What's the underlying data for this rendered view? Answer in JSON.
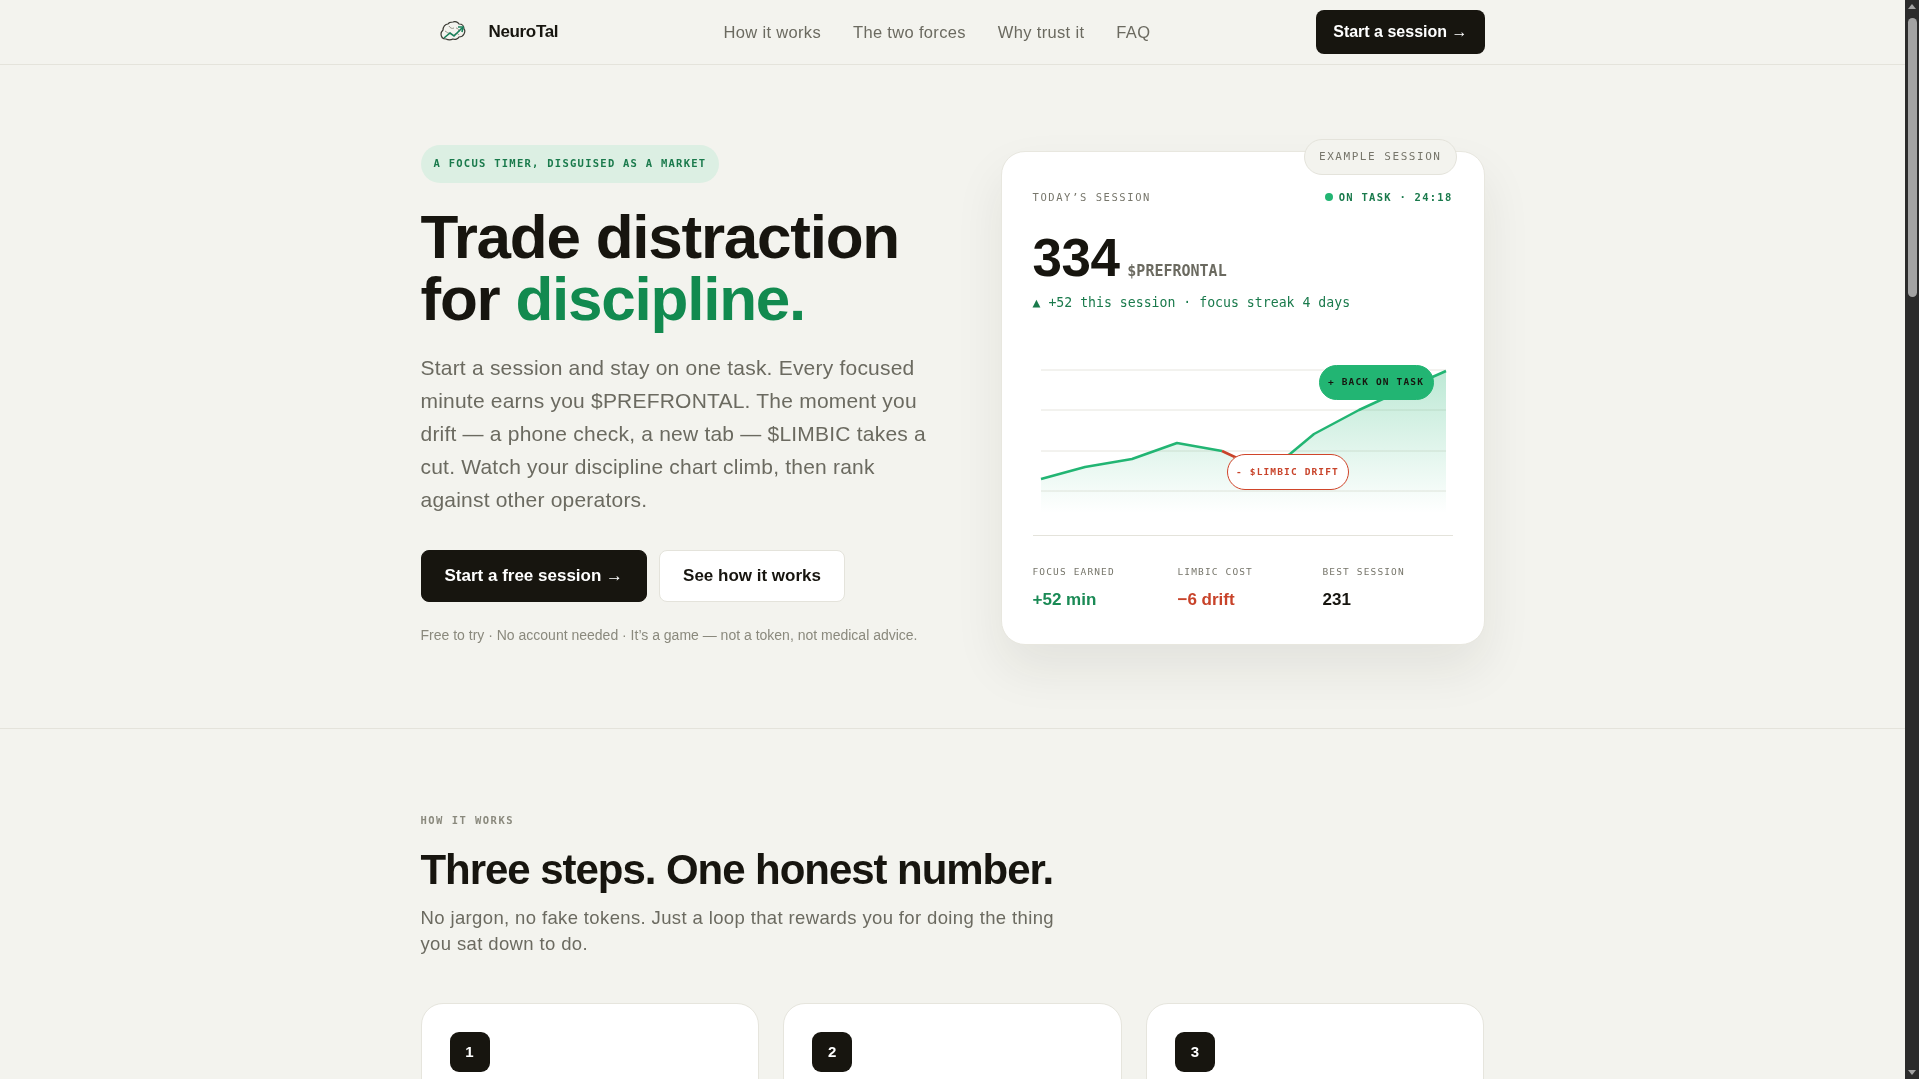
{
  "nav": {
    "brand": "NeuroTal",
    "links": [
      "How it works",
      "The two forces",
      "Why trust it",
      "FAQ"
    ],
    "cta": "Start a session →"
  },
  "hero": {
    "eyebrow": "A FOCUS TIMER, DISGUISED AS A MARKET",
    "headline_lines": [
      {
        "parts": [
          {
            "text": "Trade distraction",
            "accent": false
          }
        ]
      },
      {
        "parts": [
          {
            "text": "for",
            "accent": false
          },
          {
            "text": "discipline.",
            "accent": true
          }
        ]
      }
    ],
    "body": "Start a session and stay on one task. Every focused minute earns you $PREFRONTAL. The moment you drift — a phone check, a new tab — $LIMBIC takes a cut. Watch your discipline chart climb, then rank against other operators.",
    "buttons": [
      {
        "label": "Start a free session →",
        "kind": "primary"
      },
      {
        "label": "See how it works",
        "kind": "secondary"
      }
    ],
    "note": "Free to try · No account needed · It’s a game — not a token, not medical advice."
  },
  "session_card": {
    "badge": "EXAMPLE SESSION",
    "title": "TODAY’S SESSION",
    "status": "ON TASK · 24:18",
    "balance": "334",
    "unit": "$PREFRONTAL",
    "delta": "▲ +52 this session · focus streak 4 days",
    "annotations": [
      {
        "label": "+ BACK ON TASK",
        "kind": "gain"
      },
      {
        "label": "- $LIMBIC DRIFT",
        "kind": "loss"
      }
    ],
    "stats": [
      {
        "label": "FOCUS EARNED",
        "value": "+52 min",
        "color": "#1a8a55"
      },
      {
        "label": "LIMBIC COST",
        "value": "−6 drift",
        "color": "#c8432a"
      },
      {
        "label": "BEST SESSION",
        "value": "231",
        "color": "#17150f"
      }
    ]
  },
  "how_it_works": {
    "eyebrow": "HOW IT WORKS",
    "title": "Three steps. One honest number.",
    "subtitle": "No jargon, no fake tokens. Just a loop that rewards you for doing the thing you sat down to do.",
    "steps": [
      {
        "number": "1"
      },
      {
        "number": "2"
      },
      {
        "number": "3"
      }
    ]
  }
}
